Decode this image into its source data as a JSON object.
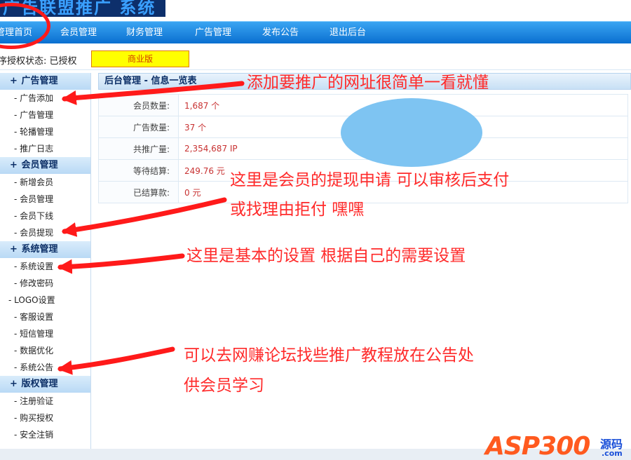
{
  "header": {
    "logo_text": "广告联盟推广 系统"
  },
  "nav": {
    "items": [
      "管理首页",
      "会员管理",
      "财务管理",
      "广告管理",
      "发布公告",
      "退出后台"
    ]
  },
  "status": {
    "text": "程序授权状态: 已授权",
    "edition": "商业版"
  },
  "sidebar": {
    "sections": [
      {
        "title": "广告管理",
        "items": [
          "- 广告添加",
          "- 广告管理",
          "- 轮播管理",
          "- 推广日志"
        ]
      },
      {
        "title": "会员管理",
        "items": [
          "- 新增会员",
          "- 会员管理",
          "- 会员下线",
          "- 会员提现"
        ]
      },
      {
        "title": "系统管理",
        "items": [
          "- 系统设置",
          "- 修改密码",
          "- LOGO设置",
          "- 客服设置",
          "- 短信管理",
          "- 数据优化",
          "- 系统公告"
        ]
      },
      {
        "title": "版权管理",
        "items": [
          "- 注册验证",
          "- 购买授权",
          "- 安全注销"
        ]
      }
    ],
    "section_symbol": "+"
  },
  "main": {
    "title": "后台管理 - 信息一览表",
    "stats": [
      {
        "label": "会员数量:",
        "value": "1,687 个"
      },
      {
        "label": "广告数量:",
        "value": "37 个"
      },
      {
        "label": "共推广量:",
        "value": "2,354,687 IP"
      },
      {
        "label": "等待结算:",
        "value": "249.76 元"
      },
      {
        "label": "已结算款:",
        "value": "0 元"
      }
    ]
  },
  "annotations": {
    "a1": "添加要推广的网址很简单一看就懂",
    "a2_line1": "这里是会员的提现申请 可以审核后支付",
    "a2_line2": "或找理由拒付 嘿嘿",
    "a3": "这里是基本的设置 根据自己的需要设置",
    "a4_line1": "可以去网赚论坛找些推广教程放在公告处",
    "a4_line2": "供会员学习",
    "color": "#ff2a2a"
  },
  "watermark": {
    "main": "ASP300",
    "side": "源码",
    "com": ".com"
  },
  "colors": {
    "nav": "#0a6fd0",
    "sidebar_section": "#b9d9f5",
    "value_red": "#c83232"
  }
}
